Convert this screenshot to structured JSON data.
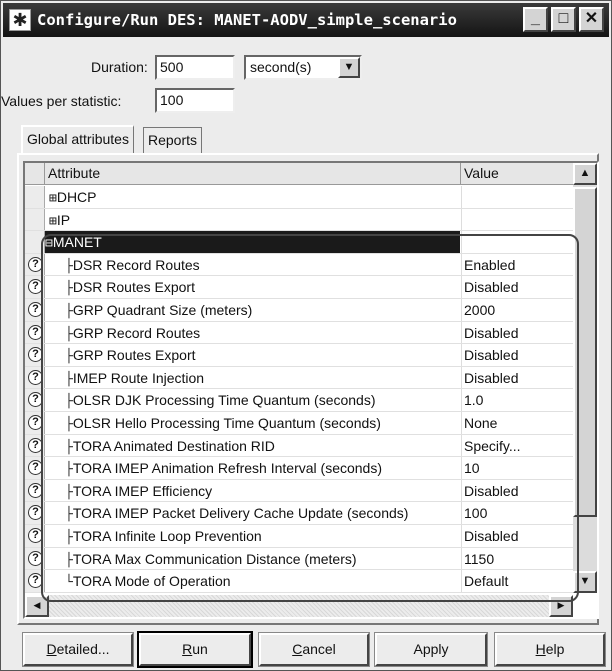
{
  "window": {
    "title": "Configure/Run DES: MANET-AODV_simple_scenario",
    "controls": [
      "minimize-icon",
      "maximize-icon",
      "close-icon"
    ]
  },
  "duration": {
    "label": "Duration:",
    "value": "500",
    "unit": "second(s)"
  },
  "values_per_statistic": {
    "label": "Values per statistic:",
    "value": "100"
  },
  "tabs": [
    {
      "label": "Global attributes",
      "active": true
    },
    {
      "label": "Reports",
      "active": false
    }
  ],
  "table": {
    "headers": {
      "attribute": "Attribute",
      "value": "Value"
    },
    "groups": [
      {
        "expander": "⊞",
        "label": "DHCP"
      },
      {
        "expander": "⊞",
        "label": "IP"
      },
      {
        "expander": "⊟",
        "label": "MANET"
      }
    ],
    "rows": [
      {
        "branch": "├",
        "label": "DSR Record Routes",
        "value": "Enabled"
      },
      {
        "branch": "├",
        "label": "DSR Routes Export",
        "value": "Disabled"
      },
      {
        "branch": "├",
        "label": "GRP Quadrant Size (meters)",
        "value": "2000"
      },
      {
        "branch": "├",
        "label": "GRP Record Routes",
        "value": "Disabled"
      },
      {
        "branch": "├",
        "label": "GRP Routes Export",
        "value": "Disabled"
      },
      {
        "branch": "├",
        "label": "IMEP Route Injection",
        "value": "Disabled"
      },
      {
        "branch": "├",
        "label": "OLSR DJK Processing Time Quantum (seconds)",
        "value": "1.0"
      },
      {
        "branch": "├",
        "label": "OLSR Hello Processing Time Quantum (seconds)",
        "value": "None"
      },
      {
        "branch": "├",
        "label": "TORA Animated Destination RID",
        "value": "Specify..."
      },
      {
        "branch": "├",
        "label": "TORA IMEP Animation Refresh Interval (seconds)",
        "value": "10"
      },
      {
        "branch": "├",
        "label": "TORA IMEP Efficiency",
        "value": "Disabled"
      },
      {
        "branch": "├",
        "label": "TORA IMEP Packet Delivery Cache Update (seconds)",
        "value": "100"
      },
      {
        "branch": "├",
        "label": "TORA Infinite Loop Prevention",
        "value": "Disabled"
      },
      {
        "branch": "├",
        "label": "TORA Max Communication Distance (meters)",
        "value": "1150"
      },
      {
        "branch": "└",
        "label": "TORA Mode of Operation",
        "value": "Default"
      }
    ]
  },
  "buttons": {
    "detailed": {
      "mnemonic": "D",
      "rest": "etailed..."
    },
    "run": {
      "mnemonic": "R",
      "rest": "un"
    },
    "cancel": {
      "mnemonic": "C",
      "rest": "ancel"
    },
    "apply": {
      "mnemonic": "",
      "rest": "Apply"
    },
    "help": {
      "mnemonic": "H",
      "rest": "elp"
    }
  }
}
